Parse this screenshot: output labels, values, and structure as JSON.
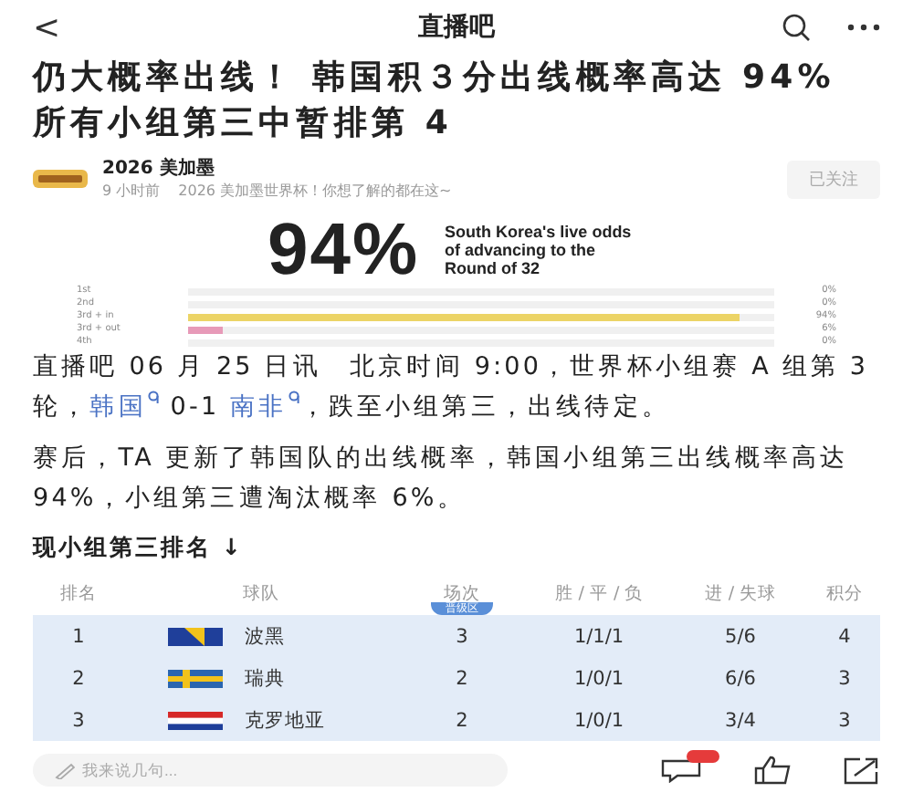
{
  "header": {
    "back": "<",
    "title": "直播吧"
  },
  "headline": "仍大概率出线！ 韩国积３分出线概率高达 94% 所有小组第三中暂排第 4",
  "author": {
    "name": "2026 美加墨",
    "time": "9 小时前",
    "bio": "2026 美加墨世界杯！你想了解的都在这~",
    "follow": "已关注"
  },
  "infographic": {
    "big": "94%",
    "caption": "South Korea's live odds of advancing to the Round of 32",
    "rows": [
      {
        "label": "1st",
        "level": 0,
        "reading": "0%"
      },
      {
        "label": "2nd",
        "level": 0,
        "reading": "0%"
      },
      {
        "label": "3rd + in",
        "level": 0.94,
        "reading": "94%",
        "color": "#ecd466"
      },
      {
        "label": "3rd + out",
        "level": 0.06,
        "reading": "6%",
        "color": "#e79ab8"
      },
      {
        "label": "4th",
        "level": 0,
        "reading": "0%"
      }
    ]
  },
  "paragraphs": [
    [
      {
        "kind": "text",
        "text": "直播吧 06 月 25 日讯　北京时间 9:00，世界杯小组赛 A 组第 3 轮，"
      },
      {
        "kind": "link",
        "text": "韩国"
      },
      {
        "kind": "text",
        "text": " 0-1 "
      },
      {
        "kind": "link",
        "text": "南非"
      },
      {
        "kind": "text",
        "text": "，跌至小组第三，出线待定。"
      }
    ],
    [
      {
        "kind": "text",
        "text": "赛后，TA 更新了韩国队的出线概率，韩国小组第三出线概率高达 94%，小组第三遭淘汰概率 6%。"
      }
    ]
  ],
  "subheading": "现小组第三排名 ↓",
  "table": {
    "columns": [
      "排名",
      "球队",
      "场次",
      "胜 / 平 / 负",
      "进 / 失球",
      "积分"
    ],
    "zone_tag": "晋级区",
    "rows": [
      {
        "rank": "1",
        "kind": "triangle",
        "team": "波黑",
        "played": "3",
        "record": "1/1/1",
        "goals": "5/6",
        "points": "4"
      },
      {
        "rank": "2",
        "kind": "cross",
        "team": "瑞典",
        "played": "2",
        "record": "1/0/1",
        "goals": "6/6",
        "points": "3"
      },
      {
        "rank": "3",
        "kind": "stripes",
        "team": "克罗地亚",
        "played": "2",
        "record": "1/0/1",
        "goals": "3/4",
        "points": "3"
      }
    ]
  },
  "bottom_bar": {
    "placeholder": "我来说几句..."
  }
}
